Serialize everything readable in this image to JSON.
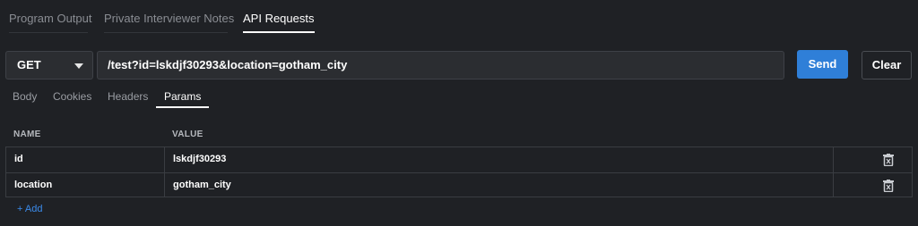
{
  "top_tabs": [
    {
      "label": "Program Output"
    },
    {
      "label": "Private Interviewer Notes"
    },
    {
      "label": "API Requests"
    }
  ],
  "request": {
    "method": "GET",
    "url": "/test?id=lskdjf30293&location=gotham_city",
    "send_label": "Send",
    "clear_label": "Clear"
  },
  "sub_tabs": [
    {
      "label": "Body"
    },
    {
      "label": "Cookies"
    },
    {
      "label": "Headers"
    },
    {
      "label": "Params"
    }
  ],
  "params": {
    "headers": {
      "name": "NAME",
      "value": "VALUE"
    },
    "rows": [
      {
        "name": "id",
        "value": "lskdjf30293",
        "delete_icon": "trash-icon"
      },
      {
        "name": "location",
        "value": "gotham_city",
        "delete_icon": "trash-icon"
      }
    ],
    "add_label": "+ Add"
  },
  "colors": {
    "background": "#1f2125",
    "accent": "#2f7fd8",
    "link": "#3b8beb"
  }
}
